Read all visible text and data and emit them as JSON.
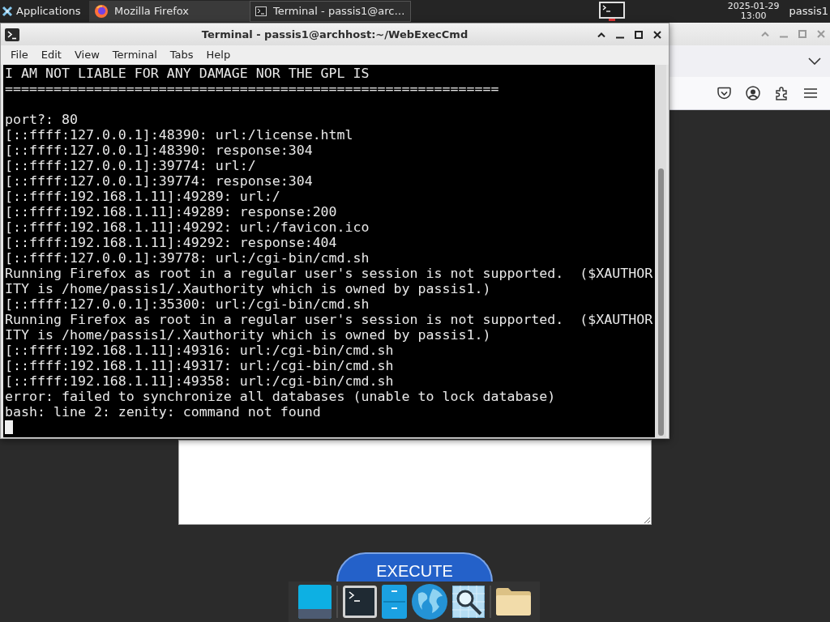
{
  "top_panel": {
    "applications_label": "Applications",
    "tasks": [
      {
        "kind": "browser",
        "label": "Mozilla Firefox",
        "selected": false
      },
      {
        "kind": "terminal",
        "label": "Terminal - passis1@arc…",
        "selected": true
      }
    ],
    "clock": {
      "date": "2025-01-29",
      "time": "13:00"
    },
    "user": "passis1"
  },
  "terminal_window": {
    "title": "Terminal - passis1@archhost:~/WebExecCmd",
    "menu": [
      "File",
      "Edit",
      "View",
      "Terminal",
      "Tabs",
      "Help"
    ],
    "banner": [
      "I AM NOT LIABLE FOR ANY DAMAGE NOR THE GPL IS",
      "============================================================="
    ],
    "log": [
      "port?: 80",
      "[::ffff:127.0.0.1]:48390: url:/license.html",
      "[::ffff:127.0.0.1]:48390: response:304",
      "[::ffff:127.0.0.1]:39774: url:/",
      "[::ffff:127.0.0.1]:39774: response:304",
      "[::ffff:192.168.1.11]:49289: url:/",
      "[::ffff:192.168.1.11]:49289: response:200",
      "[::ffff:192.168.1.11]:49292: url:/favicon.ico",
      "[::ffff:192.168.1.11]:49292: response:404",
      "[::ffff:127.0.0.1]:39778: url:/cgi-bin/cmd.sh",
      "Running Firefox as root in a regular user's session is not supported.  ($XAUTHOR",
      "ITY is /home/passis1/.Xauthority which is owned by passis1.)",
      "[::ffff:127.0.0.1]:35300: url:/cgi-bin/cmd.sh",
      "Running Firefox as root in a regular user's session is not supported.  ($XAUTHOR",
      "ITY is /home/passis1/.Xauthority which is owned by passis1.)",
      "[::ffff:192.168.1.11]:49316: url:/cgi-bin/cmd.sh",
      "[::ffff:192.168.1.11]:49317: url:/cgi-bin/cmd.sh",
      "[::ffff:192.168.1.11]:49358: url:/cgi-bin/cmd.sh",
      "error: failed to synchronize all databases (unable to lock database)",
      "bash: line 2: zenity: command not found"
    ],
    "cursor": true
  },
  "browser_window": {
    "execute_button": "EXECUTE"
  }
}
